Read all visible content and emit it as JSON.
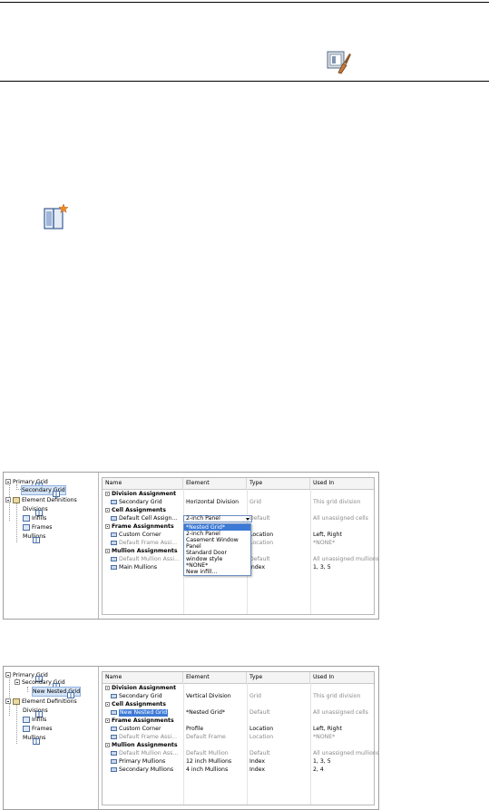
{
  "toolbar_icons": {
    "brush_icon": "paint-brush-style-icon",
    "new_grid_icon": "add-nested-grid-icon"
  },
  "shot1": {
    "tree": [
      {
        "label": "Primary Grid"
      },
      {
        "label": "Secondary Grid"
      },
      {
        "label": "Element Definitions"
      },
      {
        "label": "Divisions"
      },
      {
        "label": "Infills"
      },
      {
        "label": "Frames"
      },
      {
        "label": "Mullions"
      }
    ],
    "columns": [
      "Name",
      "Element",
      "Type",
      "Used In"
    ],
    "rows": [
      {
        "name": "Division Assignment",
        "element": "",
        "type": "",
        "used": ""
      },
      {
        "name": "Secondary Grid",
        "element": "Horizontal Division",
        "type": "Grid",
        "used": "This grid division"
      },
      {
        "name": "Cell Assignments",
        "element": "",
        "type": "",
        "used": ""
      },
      {
        "name": "Default Cell Assign...",
        "element": "2-inch Panel",
        "type": "Default",
        "used": "All unassigned cells"
      },
      {
        "name": "Frame Assignments",
        "element": "",
        "type": "",
        "used": ""
      },
      {
        "name": "Custom Corner",
        "element": "",
        "type": "Location",
        "used": "Left, Right"
      },
      {
        "name": "Default Frame Assi...",
        "element": "",
        "type": "Location",
        "used": "*NONE*"
      },
      {
        "name": "Mullion Assignments",
        "element": "",
        "type": "",
        "used": ""
      },
      {
        "name": "Default Mullion Assi...",
        "element": "",
        "type": "Default",
        "used": "All unassigned mullions"
      },
      {
        "name": "Main Mullions",
        "element": "",
        "type": "Index",
        "used": "1, 3, 5"
      }
    ],
    "dropdown": [
      "*Nested Grid*",
      "2-inch Panel",
      "Casement Window",
      "Panel",
      "Standard Door",
      "window style",
      "*NONE*",
      "New infill..."
    ]
  },
  "shot2": {
    "tree": [
      {
        "label": "Primary Grid"
      },
      {
        "label": "Secondary Grid"
      },
      {
        "label": "New Nested Grid"
      },
      {
        "label": "Element Definitions"
      },
      {
        "label": "Divisions"
      },
      {
        "label": "Infills"
      },
      {
        "label": "Frames"
      },
      {
        "label": "Mullions"
      }
    ],
    "columns": [
      "Name",
      "Element",
      "Type",
      "Used In"
    ],
    "rows": [
      {
        "name": "Division Assignment",
        "element": "",
        "type": "",
        "used": ""
      },
      {
        "name": "Secondary Grid",
        "element": "Vertical Division",
        "type": "Grid",
        "used": "This grid division"
      },
      {
        "name": "Cell Assignments",
        "element": "",
        "type": "",
        "used": ""
      },
      {
        "name": "New Nested Grid",
        "element": "*Nested Grid*",
        "type": "Default",
        "used": "All unassigned cells"
      },
      {
        "name": "Frame Assignments",
        "element": "",
        "type": "",
        "used": ""
      },
      {
        "name": "Custom Corner",
        "element": "Profile",
        "type": "Location",
        "used": "Left, Right"
      },
      {
        "name": "Default Frame Assi...",
        "element": "Default Frame",
        "type": "Location",
        "used": "*NONE*"
      },
      {
        "name": "Mullion Assignments",
        "element": "",
        "type": "",
        "used": ""
      },
      {
        "name": "Default Mullion Ass...",
        "element": "Default Mullion",
        "type": "Default",
        "used": "All unassigned mullions"
      },
      {
        "name": "Primary Mullions",
        "element": "12 inch Mullions",
        "type": "Index",
        "used": "1, 3, 5"
      },
      {
        "name": "Secondary Mullions",
        "element": "4 inch Mullions",
        "type": "Index",
        "used": "2, 4"
      }
    ]
  }
}
